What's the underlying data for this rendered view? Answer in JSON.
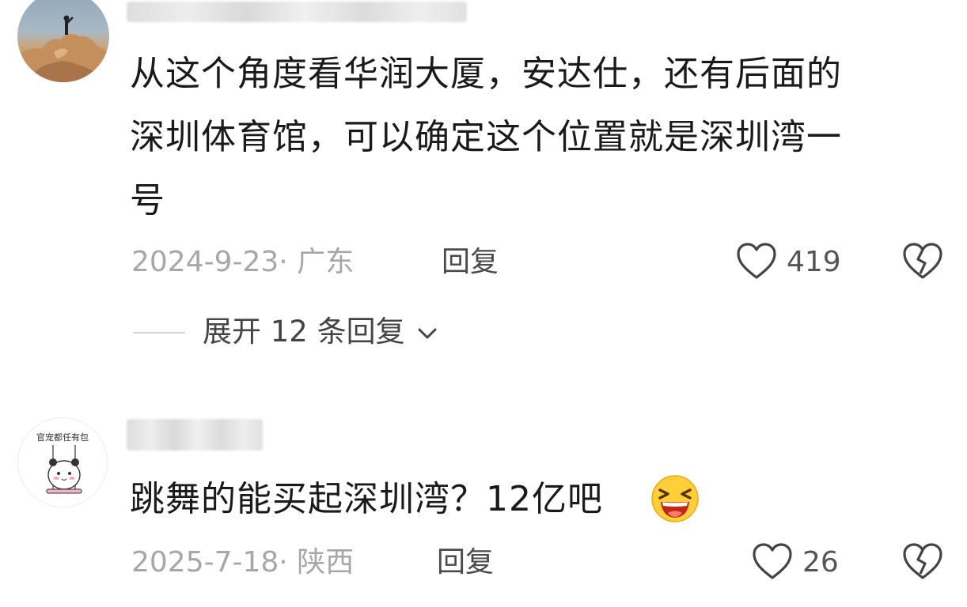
{
  "comments": [
    {
      "username": "",
      "text_lines": [
        "从这个角度看华润大厦，安达仕，还有后面的",
        "深圳体育馆，可以确定这个位置就是深圳湾一",
        "号"
      ],
      "date_location": "2024-9-23· 广东",
      "reply_label": "回复",
      "likes": "419",
      "expand_replies": "展开 12 条回复"
    },
    {
      "username": "",
      "avatar_text": "官宠都任有包",
      "text": "跳舞的能买起深圳湾？12亿吧",
      "date_location": "2025-7-18· 陕西",
      "reply_label": "回复",
      "likes": "26"
    }
  ],
  "icons": {
    "like": "heart-outline-icon",
    "dislike": "broken-heart-icon",
    "expand": "chevron-down-icon",
    "emoji": "laughing-face-emoji"
  },
  "colors": {
    "text": "#1a1a1a",
    "meta": "#a7a7a7",
    "reply": "#4a4a4a",
    "icon": "#444444"
  }
}
